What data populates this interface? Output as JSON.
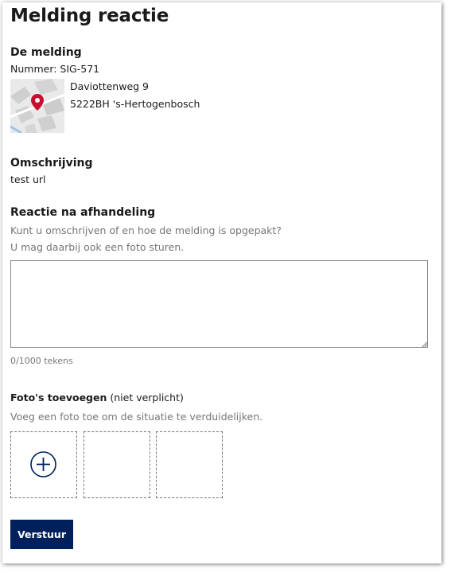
{
  "page": {
    "title": "Melding reactie"
  },
  "melding": {
    "heading": "De melding",
    "nummer": "Nummer: SIG-571",
    "map_icon": "map-pin-icon",
    "address_line1": "Daviottenweg 9",
    "address_line2": "5222BH 's-Hertogenbosch"
  },
  "omschrijving": {
    "heading": "Omschrijving",
    "value": "test url"
  },
  "reactie": {
    "heading": "Reactie na afhandeling",
    "help_line1": "Kunt u omschrijven of en hoe de melding is opgepakt?",
    "help_line2": "U mag daarbij ook een foto sturen.",
    "value": "",
    "counter": "0/1000 tekens"
  },
  "fotos": {
    "heading": "Foto's toevoegen",
    "optional": " (niet verplicht)",
    "help": "Voeg een foto toe om de situatie te verduidelijken.",
    "add_icon": "plus-circle-icon"
  },
  "submit": {
    "label": "Verstuur"
  },
  "colors": {
    "accent": "#00205b",
    "pin": "#c8102e",
    "muted": "#767676"
  }
}
